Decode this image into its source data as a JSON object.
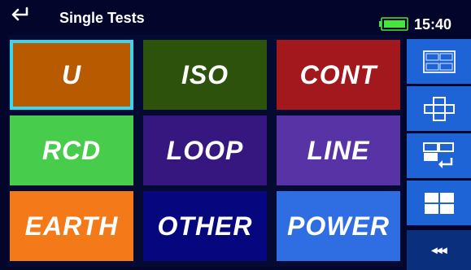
{
  "header": {
    "title": "Single Tests",
    "time": "15:40",
    "back_icon": "back-arrow-icon",
    "battery_icon": "battery-icon"
  },
  "tiles": [
    {
      "label": "U",
      "color": "#b85a00",
      "selected": true
    },
    {
      "label": "ISO",
      "color": "#2d520b"
    },
    {
      "label": "CONT",
      "color": "#a3181c"
    },
    {
      "label": "RCD",
      "color": "#47cc4b"
    },
    {
      "label": "LOOP",
      "color": "#36177f"
    },
    {
      "label": "LINE",
      "color": "#5833a6"
    },
    {
      "label": "EARTH",
      "color": "#f47a19"
    },
    {
      "label": "OTHER",
      "color": "#06077e"
    },
    {
      "label": "POWER",
      "color": "#2f6de3"
    }
  ],
  "sidebar": {
    "buttons": [
      {
        "icon": "grid-view-icon"
      },
      {
        "icon": "cross-view-icon"
      },
      {
        "icon": "grid-swap-icon"
      },
      {
        "icon": "four-tile-view-icon"
      },
      {
        "icon": "more-icon",
        "label": "◂◂◂"
      }
    ]
  }
}
